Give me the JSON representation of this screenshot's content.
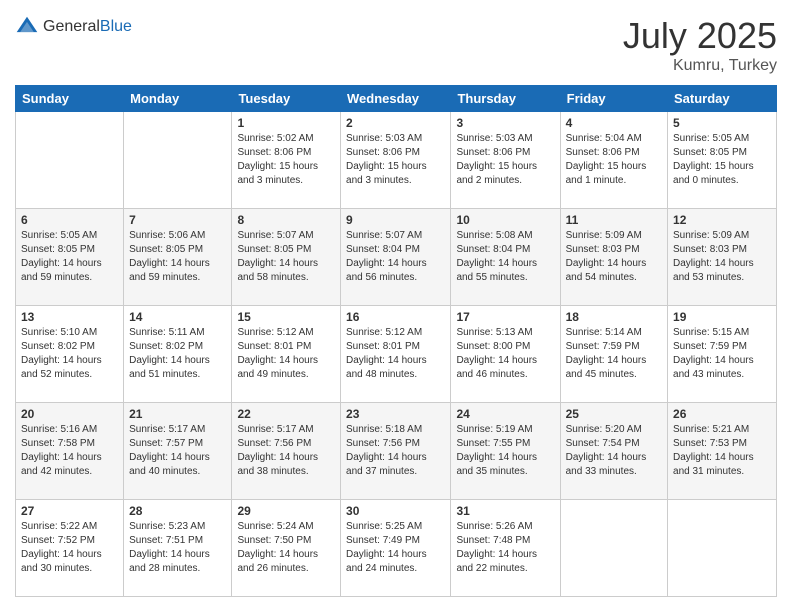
{
  "header": {
    "logo_general": "General",
    "logo_blue": "Blue",
    "title": "July 2025",
    "subtitle": "Kumru, Turkey"
  },
  "weekdays": [
    "Sunday",
    "Monday",
    "Tuesday",
    "Wednesday",
    "Thursday",
    "Friday",
    "Saturday"
  ],
  "weeks": [
    [
      {
        "day": "",
        "info": ""
      },
      {
        "day": "",
        "info": ""
      },
      {
        "day": "1",
        "info": "Sunrise: 5:02 AM\nSunset: 8:06 PM\nDaylight: 15 hours\nand 3 minutes."
      },
      {
        "day": "2",
        "info": "Sunrise: 5:03 AM\nSunset: 8:06 PM\nDaylight: 15 hours\nand 3 minutes."
      },
      {
        "day": "3",
        "info": "Sunrise: 5:03 AM\nSunset: 8:06 PM\nDaylight: 15 hours\nand 2 minutes."
      },
      {
        "day": "4",
        "info": "Sunrise: 5:04 AM\nSunset: 8:06 PM\nDaylight: 15 hours\nand 1 minute."
      },
      {
        "day": "5",
        "info": "Sunrise: 5:05 AM\nSunset: 8:05 PM\nDaylight: 15 hours\nand 0 minutes."
      }
    ],
    [
      {
        "day": "6",
        "info": "Sunrise: 5:05 AM\nSunset: 8:05 PM\nDaylight: 14 hours\nand 59 minutes."
      },
      {
        "day": "7",
        "info": "Sunrise: 5:06 AM\nSunset: 8:05 PM\nDaylight: 14 hours\nand 59 minutes."
      },
      {
        "day": "8",
        "info": "Sunrise: 5:07 AM\nSunset: 8:05 PM\nDaylight: 14 hours\nand 58 minutes."
      },
      {
        "day": "9",
        "info": "Sunrise: 5:07 AM\nSunset: 8:04 PM\nDaylight: 14 hours\nand 56 minutes."
      },
      {
        "day": "10",
        "info": "Sunrise: 5:08 AM\nSunset: 8:04 PM\nDaylight: 14 hours\nand 55 minutes."
      },
      {
        "day": "11",
        "info": "Sunrise: 5:09 AM\nSunset: 8:03 PM\nDaylight: 14 hours\nand 54 minutes."
      },
      {
        "day": "12",
        "info": "Sunrise: 5:09 AM\nSunset: 8:03 PM\nDaylight: 14 hours\nand 53 minutes."
      }
    ],
    [
      {
        "day": "13",
        "info": "Sunrise: 5:10 AM\nSunset: 8:02 PM\nDaylight: 14 hours\nand 52 minutes."
      },
      {
        "day": "14",
        "info": "Sunrise: 5:11 AM\nSunset: 8:02 PM\nDaylight: 14 hours\nand 51 minutes."
      },
      {
        "day": "15",
        "info": "Sunrise: 5:12 AM\nSunset: 8:01 PM\nDaylight: 14 hours\nand 49 minutes."
      },
      {
        "day": "16",
        "info": "Sunrise: 5:12 AM\nSunset: 8:01 PM\nDaylight: 14 hours\nand 48 minutes."
      },
      {
        "day": "17",
        "info": "Sunrise: 5:13 AM\nSunset: 8:00 PM\nDaylight: 14 hours\nand 46 minutes."
      },
      {
        "day": "18",
        "info": "Sunrise: 5:14 AM\nSunset: 7:59 PM\nDaylight: 14 hours\nand 45 minutes."
      },
      {
        "day": "19",
        "info": "Sunrise: 5:15 AM\nSunset: 7:59 PM\nDaylight: 14 hours\nand 43 minutes."
      }
    ],
    [
      {
        "day": "20",
        "info": "Sunrise: 5:16 AM\nSunset: 7:58 PM\nDaylight: 14 hours\nand 42 minutes."
      },
      {
        "day": "21",
        "info": "Sunrise: 5:17 AM\nSunset: 7:57 PM\nDaylight: 14 hours\nand 40 minutes."
      },
      {
        "day": "22",
        "info": "Sunrise: 5:17 AM\nSunset: 7:56 PM\nDaylight: 14 hours\nand 38 minutes."
      },
      {
        "day": "23",
        "info": "Sunrise: 5:18 AM\nSunset: 7:56 PM\nDaylight: 14 hours\nand 37 minutes."
      },
      {
        "day": "24",
        "info": "Sunrise: 5:19 AM\nSunset: 7:55 PM\nDaylight: 14 hours\nand 35 minutes."
      },
      {
        "day": "25",
        "info": "Sunrise: 5:20 AM\nSunset: 7:54 PM\nDaylight: 14 hours\nand 33 minutes."
      },
      {
        "day": "26",
        "info": "Sunrise: 5:21 AM\nSunset: 7:53 PM\nDaylight: 14 hours\nand 31 minutes."
      }
    ],
    [
      {
        "day": "27",
        "info": "Sunrise: 5:22 AM\nSunset: 7:52 PM\nDaylight: 14 hours\nand 30 minutes."
      },
      {
        "day": "28",
        "info": "Sunrise: 5:23 AM\nSunset: 7:51 PM\nDaylight: 14 hours\nand 28 minutes."
      },
      {
        "day": "29",
        "info": "Sunrise: 5:24 AM\nSunset: 7:50 PM\nDaylight: 14 hours\nand 26 minutes."
      },
      {
        "day": "30",
        "info": "Sunrise: 5:25 AM\nSunset: 7:49 PM\nDaylight: 14 hours\nand 24 minutes."
      },
      {
        "day": "31",
        "info": "Sunrise: 5:26 AM\nSunset: 7:48 PM\nDaylight: 14 hours\nand 22 minutes."
      },
      {
        "day": "",
        "info": ""
      },
      {
        "day": "",
        "info": ""
      }
    ]
  ]
}
